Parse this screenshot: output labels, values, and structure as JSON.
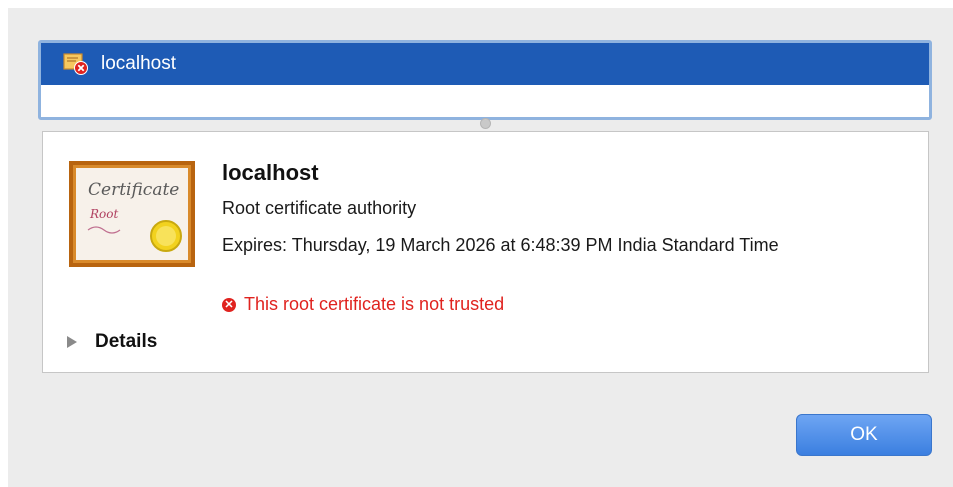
{
  "cert_list": {
    "items": [
      {
        "label": "localhost",
        "icon": "certificate-error-icon",
        "selected": true
      }
    ],
    "selected_bg": "#1e5bb5"
  },
  "detail": {
    "image": {
      "icon": "root-certificate-image",
      "script_text": "Certificate",
      "sub_text": "Root"
    },
    "name": "localhost",
    "type": "Root certificate authority",
    "expires": "Expires: Thursday, 19 March 2026 at 6:48:39 PM India Standard Time",
    "status": {
      "icon": "error-circle-icon",
      "text": "This root certificate is not trusted",
      "color": "#e0231f"
    },
    "details_toggle": {
      "icon": "disclosure-triangle-icon",
      "label": "Details",
      "expanded": false
    }
  },
  "buttons": {
    "ok_label": "OK",
    "ok_color": "#3b7fe0"
  }
}
